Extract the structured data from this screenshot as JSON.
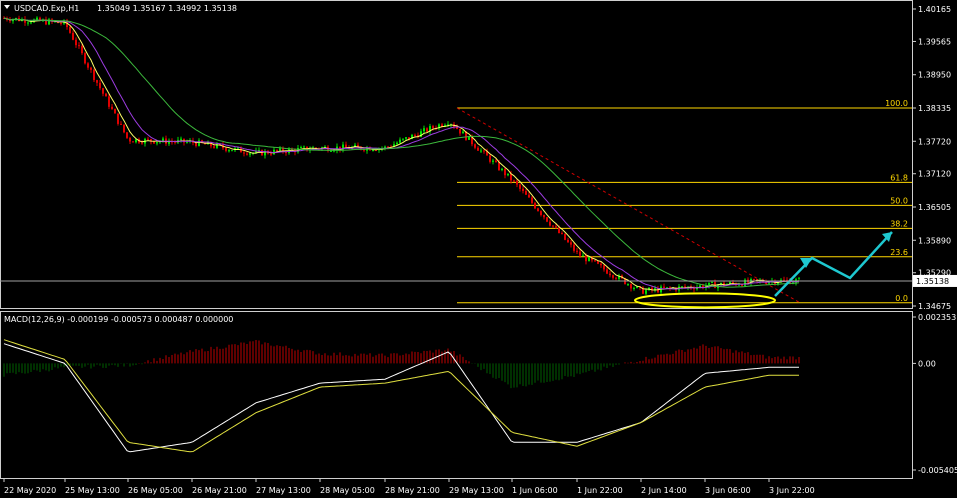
{
  "header": {
    "triangle_icon": "dropdown-triangle-icon",
    "symbol": "USDCAD.Exp,H1",
    "ohlc": "1.35049 1.35167 1.34992 1.35138"
  },
  "macd_header": "MACD(12,26,9) -0.000199 -0.000573 0.000487 0.000000",
  "price_axis": {
    "ticks": [
      "1.40165",
      "1.39565",
      "1.38950",
      "1.38335",
      "1.37720",
      "1.37120",
      "1.36505",
      "1.35890",
      "1.35290",
      "1.34675"
    ],
    "current_price": "1.35138"
  },
  "macd_axis": {
    "ticks": [
      "0.002353",
      "0.00",
      "-0.005405"
    ]
  },
  "time_axis": {
    "ticks": [
      "22 May 2020",
      "25 May 13:00",
      "26 May 05:00",
      "26 May 21:00",
      "27 May 13:00",
      "28 May 05:00",
      "28 May 21:00",
      "29 May 13:00",
      "1 Jun 06:00",
      "1 Jun 22:00",
      "2 Jun 14:00",
      "3 Jun 06:00",
      "3 Jun 22:00"
    ]
  },
  "fibonacci": {
    "levels": [
      "100.0",
      "61.8",
      "50.0",
      "38.2",
      "23.6",
      "0.0"
    ]
  },
  "colors": {
    "bull": "#00e000",
    "bear": "#e00000",
    "ma_fast": "#ffff66",
    "ma_mid": "#9c3ce0",
    "ma_slow": "#3cb83c",
    "fib": "#ffd700",
    "arrow": "#1ec8d0",
    "ellipse": "#ffff00",
    "macd_main": "#ffffff",
    "macd_signal": "#e0e040",
    "hist_pos": "#c00000",
    "hist_neg": "#006000"
  },
  "chart_data": {
    "type": "line",
    "title": "USDCAD.Exp,H1",
    "price_range": [
      1.34675,
      1.40165
    ],
    "macd_range": [
      -0.005405,
      0.002353
    ],
    "price_path": {
      "x": [
        "22 May 2020",
        "25 May 13:00",
        "26 May 05:00",
        "26 May 21:00",
        "27 May 13:00",
        "28 May 05:00",
        "28 May 21:00",
        "29 May 13:00",
        "1 Jun 06:00",
        "1 Jun 22:00",
        "2 Jun 14:00",
        "3 Jun 06:00",
        "3 Jun 22:00"
      ],
      "y": [
        1.4,
        1.399,
        1.3775,
        1.377,
        1.375,
        1.376,
        1.376,
        1.381,
        1.37,
        1.3565,
        1.3495,
        1.3505,
        1.3514
      ]
    },
    "macd": {
      "x": [
        "22 May 2020",
        "25 May 13:00",
        "26 May 05:00",
        "26 May 21:00",
        "27 May 13:00",
        "28 May 05:00",
        "28 May 21:00",
        "29 May 13:00",
        "1 Jun 06:00",
        "1 Jun 22:00",
        "2 Jun 14:00",
        "3 Jun 06:00",
        "3 Jun 22:00"
      ],
      "histogram": [
        -0.0006,
        -0.0002,
        -0.0001,
        0.0006,
        0.0011,
        0.0005,
        0.0004,
        0.0007,
        -0.0012,
        -0.0006,
        0.0002,
        0.0009,
        0.0003
      ],
      "main": [
        0.001,
        0.0,
        -0.0045,
        -0.004,
        -0.002,
        -0.001,
        -0.0008,
        0.0006,
        -0.004,
        -0.004,
        -0.003,
        -0.0005,
        -0.0002
      ],
      "signal": [
        0.0012,
        0.0002,
        -0.004,
        -0.0045,
        -0.0025,
        -0.0012,
        -0.001,
        -0.0004,
        -0.0035,
        -0.0042,
        -0.003,
        -0.0012,
        -0.0006
      ]
    }
  }
}
